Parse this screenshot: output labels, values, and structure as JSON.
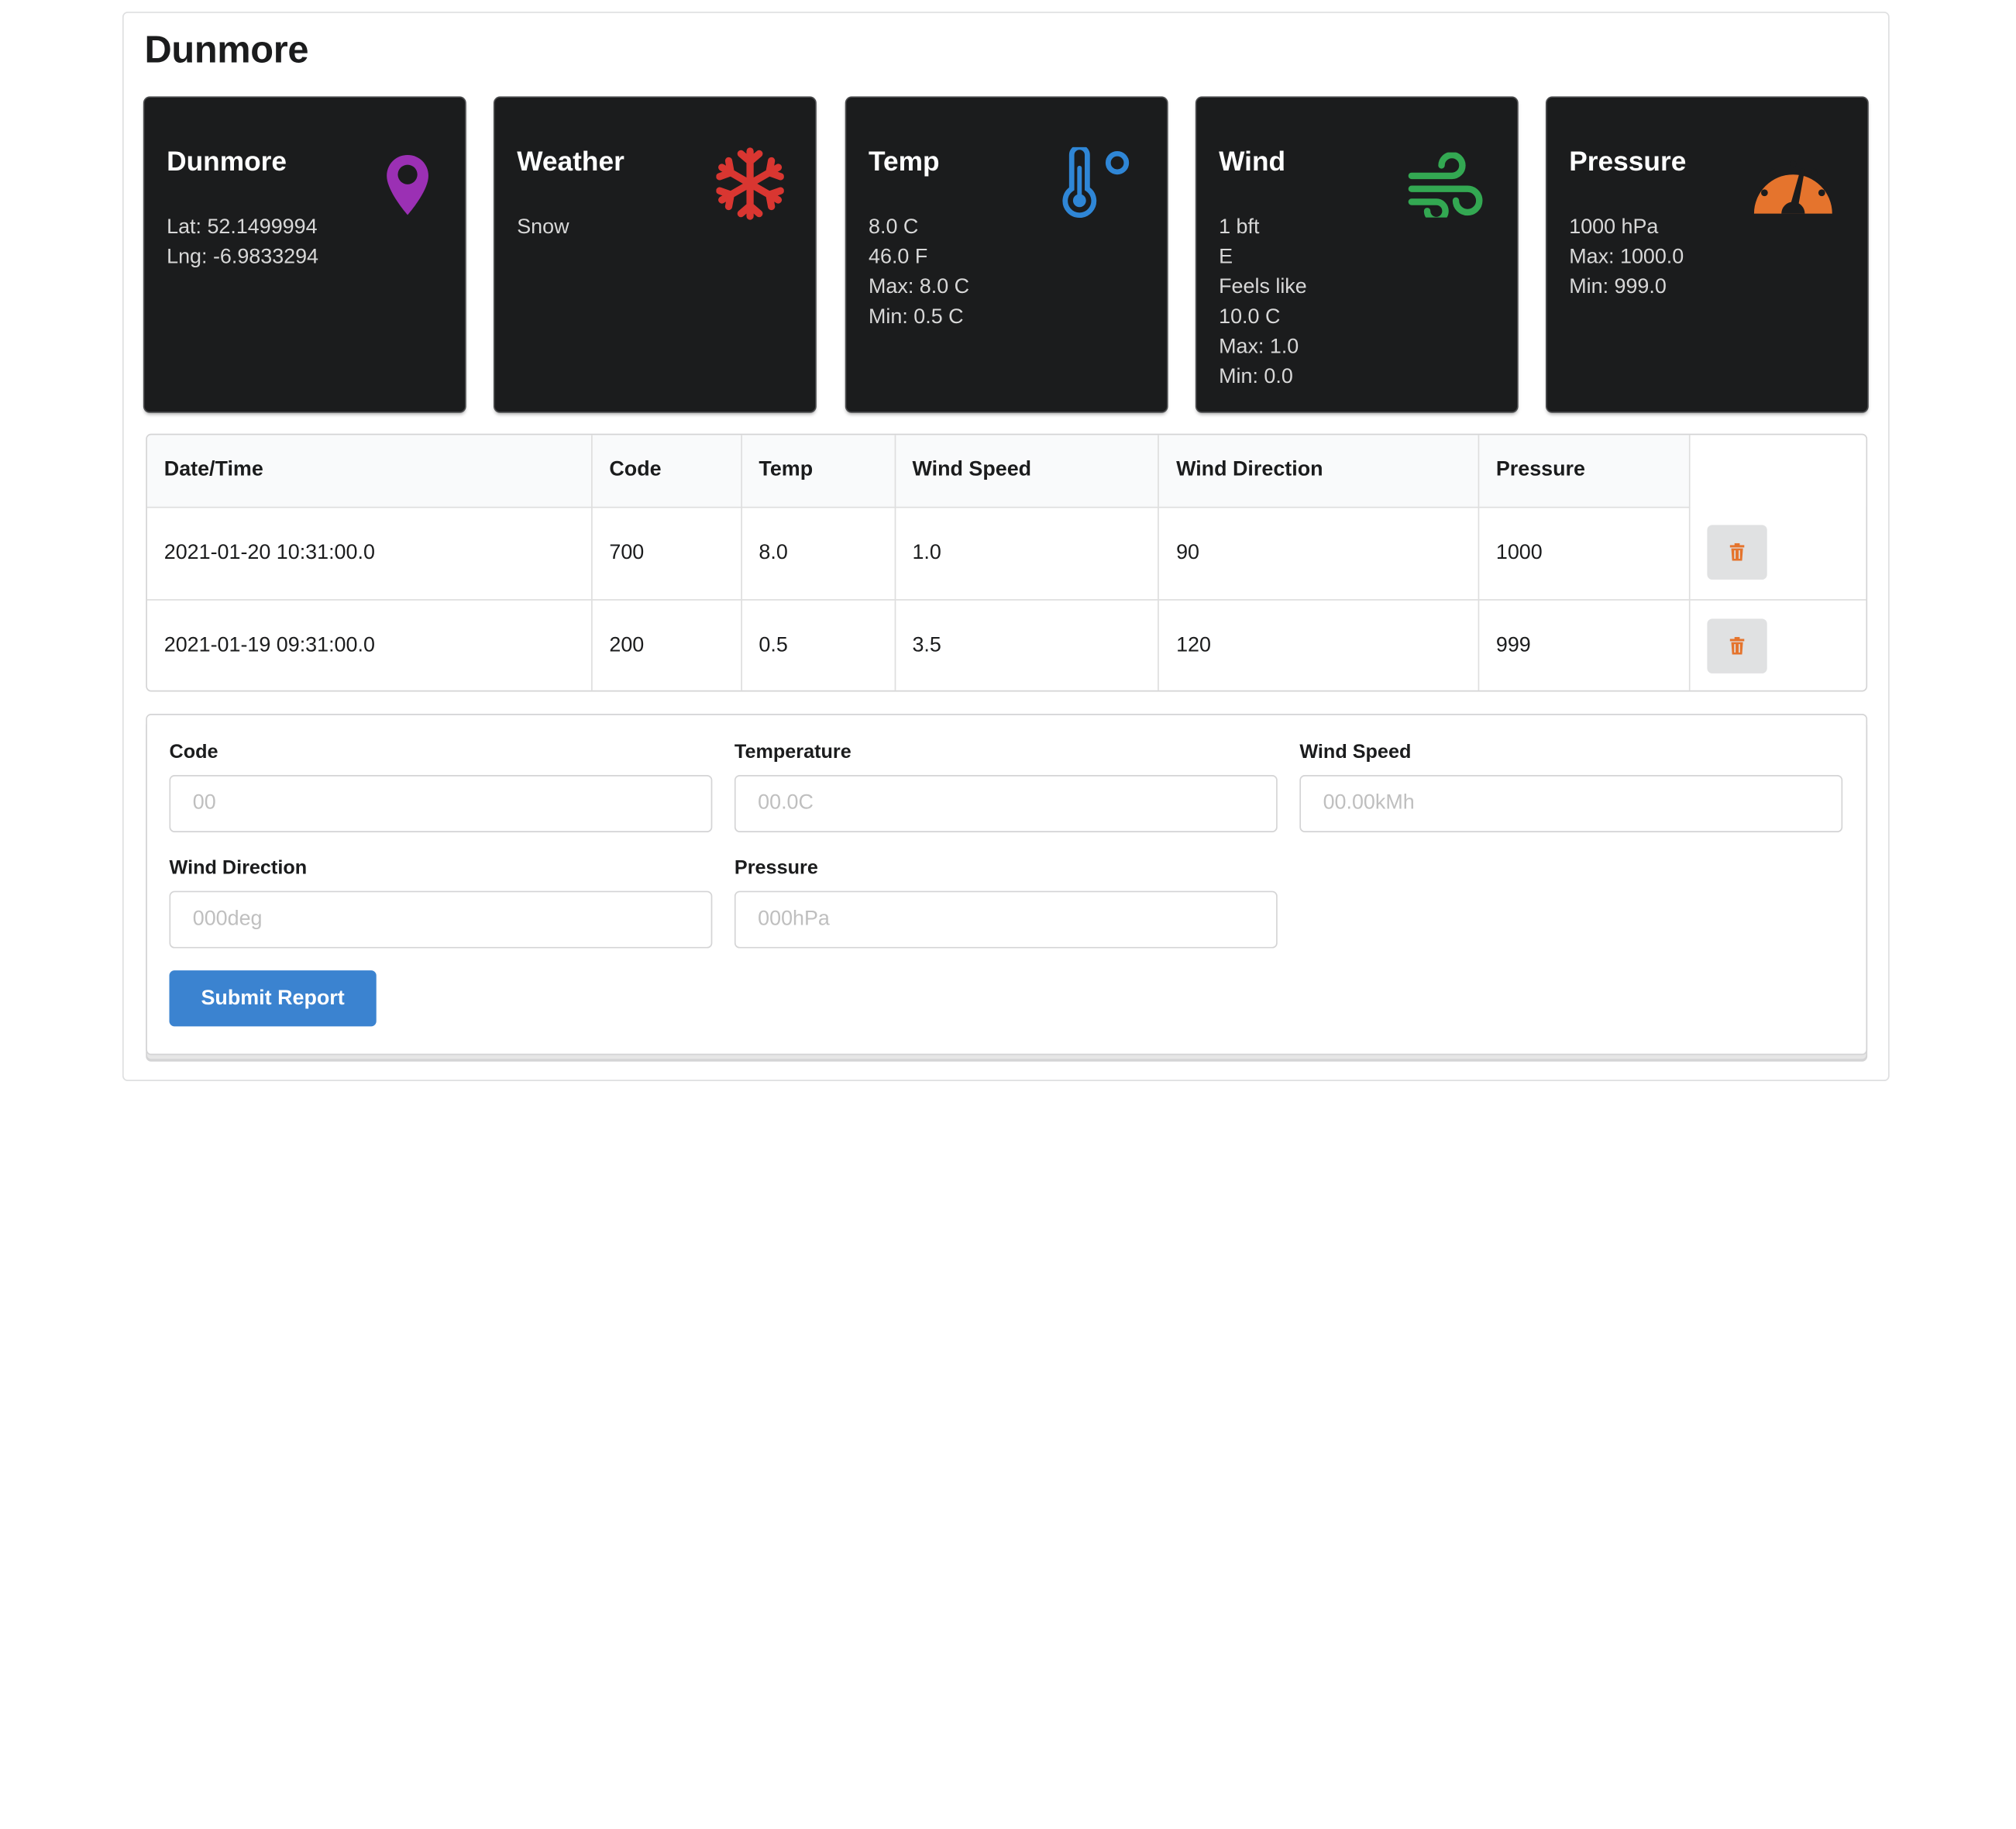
{
  "page": {
    "title": "Dunmore"
  },
  "cards": {
    "location": {
      "title": "Dunmore",
      "lat": "Lat: 52.1499994",
      "lng": "Lng: -6.9833294",
      "icon": "map-pin-icon",
      "color": "#9b30b4"
    },
    "weather": {
      "title": "Weather",
      "condition": "Snow",
      "icon": "snowflake-icon",
      "color": "#d93631"
    },
    "temp": {
      "title": "Temp",
      "celsius": "8.0 C",
      "fahrenheit": "46.0 F",
      "max": "Max: 8.0 C",
      "min": "Min: 0.5 C",
      "icon": "thermometer-icon",
      "color": "#2f86d6"
    },
    "wind": {
      "title": "Wind",
      "beaufort": "1 bft",
      "direction": "E",
      "feels_like_label": "Feels like",
      "feels_like": "10.0 C",
      "max": "Max: 1.0",
      "min": "Min: 0.0",
      "icon": "wind-icon",
      "color": "#33a852"
    },
    "pressure": {
      "title": "Pressure",
      "value": "1000 hPa",
      "max": "Max: 1000.0",
      "min": "Min: 999.0",
      "icon": "gauge-icon",
      "color": "#e5742d"
    }
  },
  "table": {
    "headers": [
      "Date/Time",
      "Code",
      "Temp",
      "Wind Speed",
      "Wind Direction",
      "Pressure"
    ],
    "rows": [
      [
        "2021-01-20 10:31:00.0",
        "700",
        "8.0",
        "1.0",
        "90",
        "1000"
      ],
      [
        "2021-01-19 09:31:00.0",
        "200",
        "0.5",
        "3.5",
        "120",
        "999"
      ]
    ],
    "delete_icon": "trash-icon",
    "delete_color": "#e5742d"
  },
  "form": {
    "code": {
      "label": "Code",
      "placeholder": "00"
    },
    "temperature": {
      "label": "Temperature",
      "placeholder": "00.0C"
    },
    "wind_speed": {
      "label": "Wind Speed",
      "placeholder": "00.00kMh"
    },
    "wind_direction": {
      "label": "Wind Direction",
      "placeholder": "000deg"
    },
    "pressure": {
      "label": "Pressure",
      "placeholder": "000hPa"
    },
    "submit_label": "Submit Report",
    "submit_color": "#3b83d0"
  }
}
